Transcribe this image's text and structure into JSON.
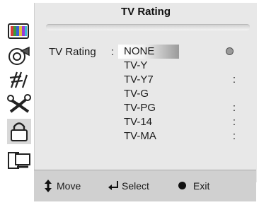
{
  "menu": {
    "title": "TV Rating",
    "field_label": "TV Rating",
    "field_colon": ":",
    "options": [
      {
        "label": "NONE",
        "selected": true,
        "mark": "circle"
      },
      {
        "label": "TV-Y",
        "selected": false,
        "mark": ""
      },
      {
        "label": "TV-Y7",
        "selected": false,
        "mark": ":"
      },
      {
        "label": "TV-G",
        "selected": false,
        "mark": ""
      },
      {
        "label": "TV-PG",
        "selected": false,
        "mark": ":"
      },
      {
        "label": "TV-14",
        "selected": false,
        "mark": ":"
      },
      {
        "label": "TV-MA",
        "selected": false,
        "mark": ":"
      }
    ]
  },
  "sidebar": {
    "icons": [
      "picture-icon",
      "sound-icon",
      "channel-antenna-icon",
      "setup-tools-icon",
      "lock-icon",
      "pc-input-icon"
    ]
  },
  "footer": {
    "move_label": "Move",
    "select_label": "Select",
    "exit_label": "Exit"
  },
  "colors": {
    "panel": "#e8e8e8",
    "footer": "#d0d0d0",
    "text": "#1a1a1a"
  }
}
